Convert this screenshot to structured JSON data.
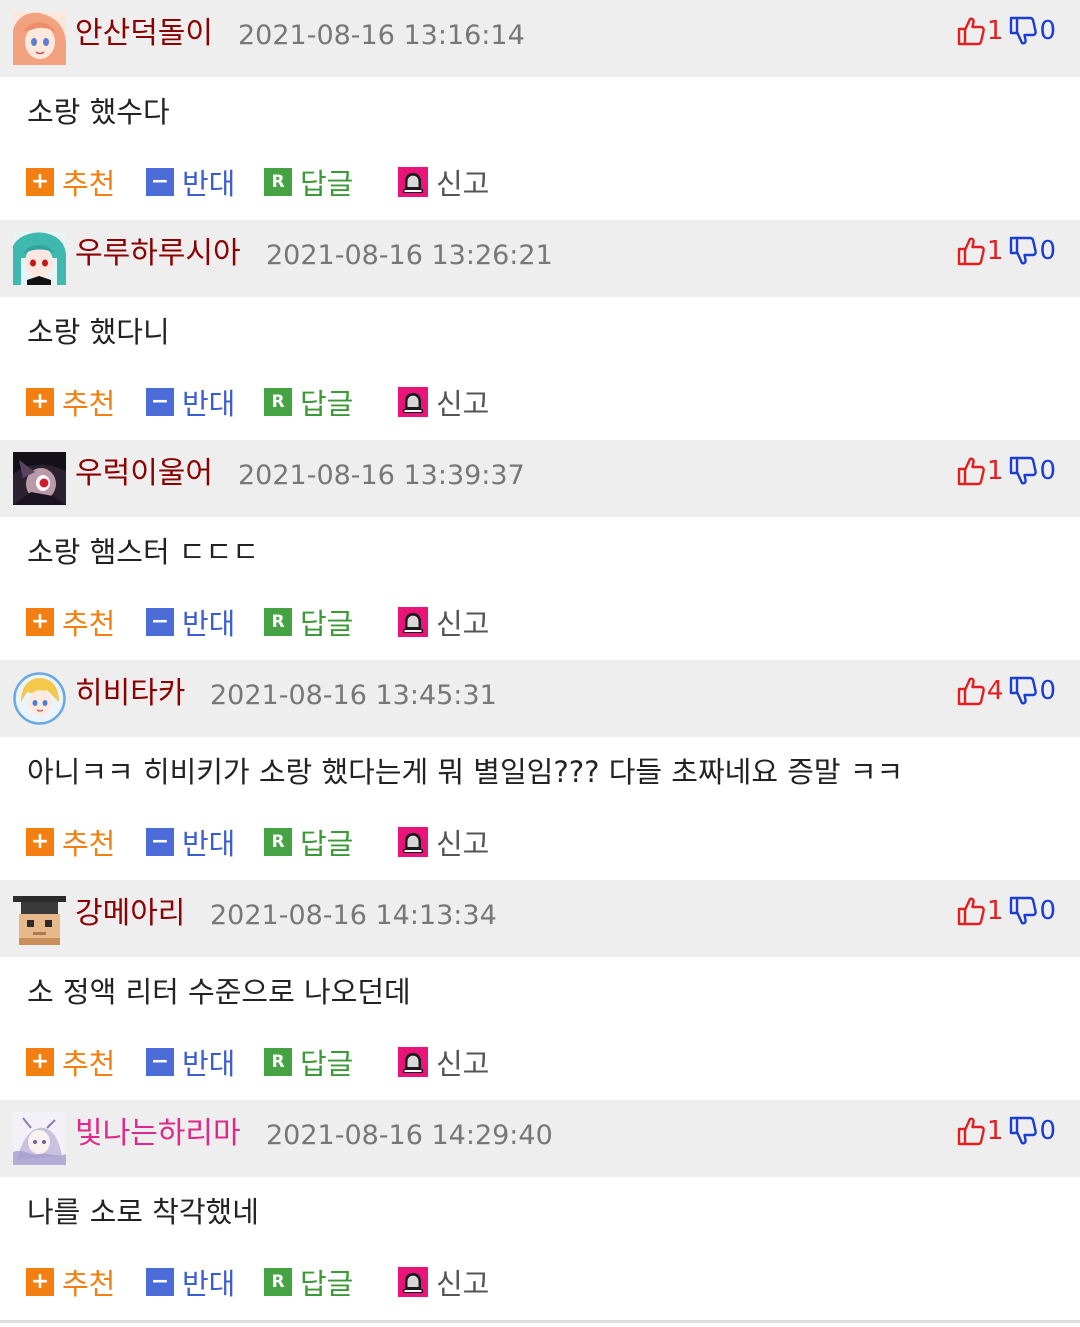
{
  "actions": {
    "recommend": "추천",
    "oppose": "반대",
    "reply": "답글",
    "report": "신고",
    "reply_badge": "R"
  },
  "colors": {
    "header_bg": "#eeeeee",
    "nickname": "#8b0000",
    "nickname_special": "#e0288a",
    "upvote": "#e02020",
    "downvote": "#1a3ecf",
    "recommend": "#f37f10",
    "oppose": "#4b6bd8",
    "reply": "#45a343",
    "report_icon": "#e8147a"
  },
  "comments": [
    {
      "nickname": "안산덕돌이",
      "datetime": "2021-08-16 13:16:14",
      "upvotes": "1",
      "downvotes": "0",
      "text": "소랑 했수다",
      "avatar": "anime-girl-orange-hair-avatar"
    },
    {
      "nickname": "우루하루시아",
      "datetime": "2021-08-16 13:26:21",
      "upvotes": "1",
      "downvotes": "0",
      "text": "소랑 했다니",
      "avatar": "anime-girl-teal-hair-avatar"
    },
    {
      "nickname": "우럭이울어",
      "datetime": "2021-08-16 13:39:37",
      "upvotes": "1",
      "downvotes": "0",
      "text": "소랑 햄스터 ㄷㄷㄷ",
      "avatar": "dark-hood-character-avatar"
    },
    {
      "nickname": "히비타카",
      "datetime": "2021-08-16 13:45:31",
      "upvotes": "4",
      "downvotes": "0",
      "text": "아니ㅋㅋ 히비키가 소랑 했다는게 뭐 별일임??? 다들 초짜네요 증말 ㅋㅋ",
      "avatar": "blonde-girl-circle-avatar"
    },
    {
      "nickname": "강메아리",
      "datetime": "2021-08-16 14:13:34",
      "upvotes": "1",
      "downvotes": "0",
      "text": "소 정액 리터 수준으로 나오던데",
      "avatar": "pixel-graduate-avatar"
    },
    {
      "nickname": "빛나는하리마",
      "datetime": "2021-08-16 14:29:40",
      "upvotes": "1",
      "downvotes": "0",
      "text": "나를 소로 착각했네",
      "avatar": "pastel-sketch-avatar"
    }
  ]
}
